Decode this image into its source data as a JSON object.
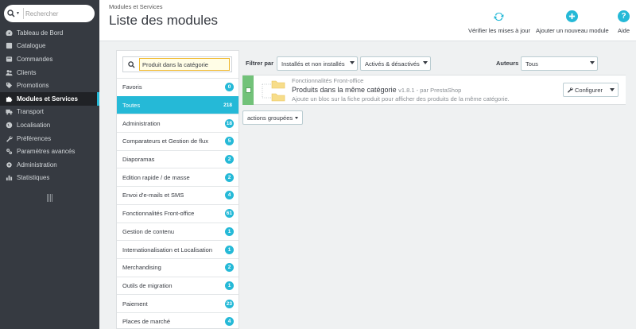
{
  "sidebar": {
    "search_placeholder": "Rechercher",
    "items": [
      {
        "label": "Tableau de Bord",
        "icon": "speedometer-icon",
        "active": false
      },
      {
        "label": "Catalogue",
        "icon": "catalog-icon",
        "active": false
      },
      {
        "label": "Commandes",
        "icon": "cart-icon",
        "active": false
      },
      {
        "label": "Clients",
        "icon": "users-icon",
        "active": false
      },
      {
        "label": "Promotions",
        "icon": "tag-icon",
        "active": false
      },
      {
        "label": "Modules et Services",
        "icon": "puzzle-icon",
        "active": true
      },
      {
        "label": "Transport",
        "icon": "truck-icon",
        "active": false
      },
      {
        "label": "Localisation",
        "icon": "globe-icon",
        "active": false
      },
      {
        "label": "Préférences",
        "icon": "wrench-icon",
        "active": false
      },
      {
        "label": "Paramètres avancés",
        "icon": "cogs-icon",
        "active": false
      },
      {
        "label": "Administration",
        "icon": "gear-icon",
        "active": false
      },
      {
        "label": "Statistiques",
        "icon": "bar-chart-icon",
        "active": false
      }
    ]
  },
  "header": {
    "breadcrumb": "Modules et Services",
    "title": "Liste des modules",
    "buttons": [
      {
        "label": "Vérifier les mises à jour",
        "icon": "refresh-icon"
      },
      {
        "label": "Ajouter un nouveau module",
        "icon": "plus-circle-icon"
      },
      {
        "label": "Aide",
        "icon": "help-icon"
      }
    ]
  },
  "categories": {
    "search_value": "Produit dans la catégorie",
    "items": [
      {
        "label": "Favoris",
        "count": "0",
        "active": false
      },
      {
        "label": "Toutes",
        "count": "218",
        "active": true
      },
      {
        "label": "Administration",
        "count": "18",
        "active": false
      },
      {
        "label": "Comparateurs et Gestion de flux",
        "count": "5",
        "active": false
      },
      {
        "label": "Diaporamas",
        "count": "2",
        "active": false
      },
      {
        "label": "Edition rapide / de masse",
        "count": "2",
        "active": false
      },
      {
        "label": "Envoi d'e-mails et SMS",
        "count": "4",
        "active": false
      },
      {
        "label": "Fonctionnalités Front-office",
        "count": "61",
        "active": false
      },
      {
        "label": "Gestion de contenu",
        "count": "1",
        "active": false
      },
      {
        "label": "Internationalisation et Localisation",
        "count": "1",
        "active": false
      },
      {
        "label": "Merchandising",
        "count": "2",
        "active": false
      },
      {
        "label": "Outils de migration",
        "count": "1",
        "active": false
      },
      {
        "label": "Paiement",
        "count": "23",
        "active": false
      },
      {
        "label": "Places de marché",
        "count": "4",
        "active": false
      }
    ]
  },
  "filters": {
    "label": "Filtrer par",
    "install_select": "Installés et non installés",
    "status_select": "Activés & désactivés",
    "authors_label": "Auteurs",
    "authors_select": "Tous"
  },
  "module": {
    "category": "Fonctionnalités Front-office",
    "name": "Produits dans la même catégorie",
    "version": "v1.8.1 - par PrestaShop",
    "description": "Ajoute un bloc sur la fiche produit pour afficher des produits de la même catégorie.",
    "configure_label": "Configurer"
  },
  "bulk_actions_label": "actions groupées",
  "colors": {
    "sidebar_bg": "#363a41",
    "accent": "#25b9d7",
    "installed_green": "#72c279"
  }
}
